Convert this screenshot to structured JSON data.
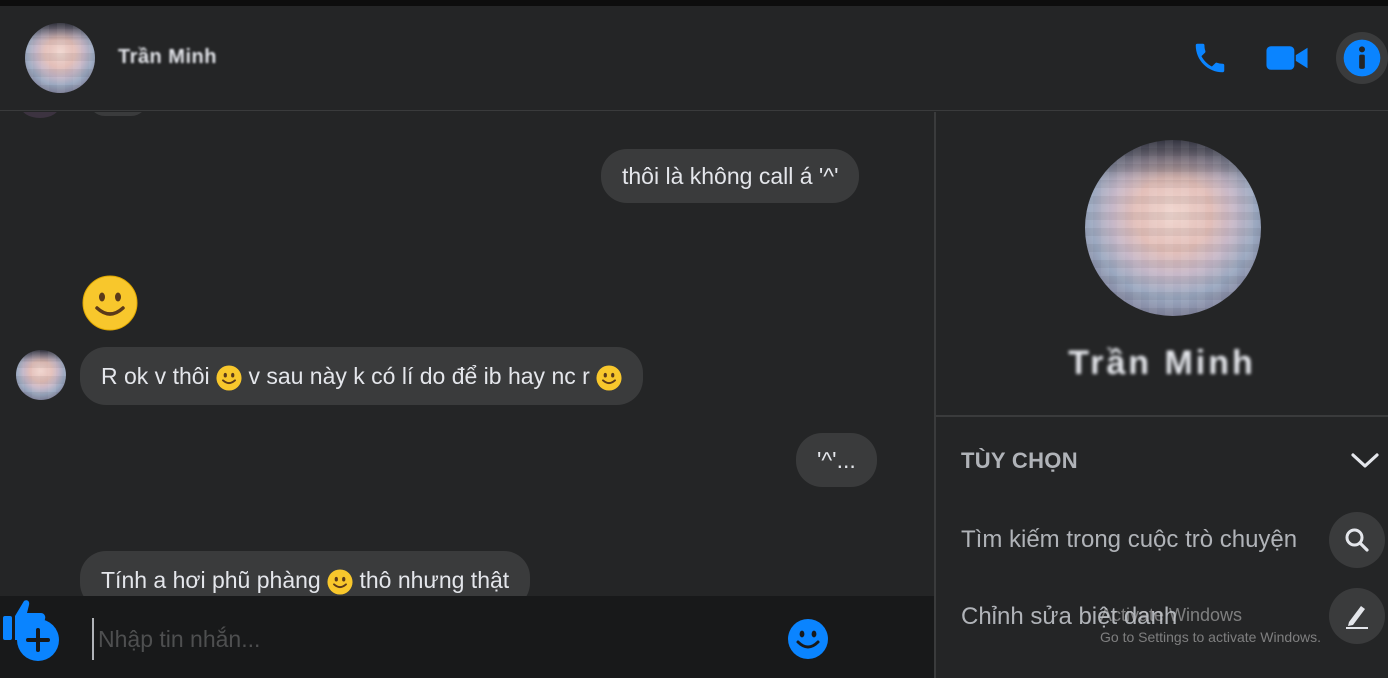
{
  "header": {
    "contact_name": "Trần Minh",
    "icons": {
      "phone": "phone-icon",
      "video": "video-camera-icon",
      "info": "info-icon"
    },
    "accent_color": "#0a84ff"
  },
  "messages": [
    {
      "side": "outgoing",
      "text": "thôi là không call á '^'"
    },
    {
      "side": "incoming",
      "emoji_only": "slightly-smiling-face"
    },
    {
      "side": "incoming",
      "text_parts": [
        "R ok v thôi ",
        " v sau này k có lí do để ib hay nc r "
      ]
    },
    {
      "side": "outgoing",
      "text": "'^'..."
    },
    {
      "side": "incoming",
      "text_parts": [
        "Tính a hơi phũ phàng ",
        " thô nhưng thật"
      ]
    }
  ],
  "composer": {
    "placeholder": "Nhập tin nhắn...",
    "icons": {
      "add": "plus-circle-icon",
      "emoji": "emoji-icon",
      "like": "thumbs-up-icon"
    }
  },
  "sidebar": {
    "contact_name": "Trần Minh",
    "options_title": "TÙY CHỌN",
    "options": [
      {
        "label": "Tìm kiếm trong cuộc trò chuyện",
        "icon": "search-icon"
      },
      {
        "label": "Chỉnh sửa biệt danh",
        "icon": "pencil-icon"
      }
    ]
  },
  "watermark": {
    "line1": "Activate Windows",
    "line2": "Go to Settings to activate Windows."
  }
}
